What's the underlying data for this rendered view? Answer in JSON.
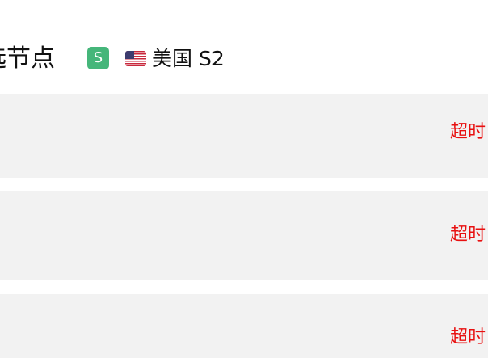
{
  "header": {
    "title": "选节点",
    "badge": "S",
    "node_country_flag": "us-flag-icon",
    "node_label": "美国 S2"
  },
  "nodes": [
    {
      "status": "超时"
    },
    {
      "status": "超时"
    },
    {
      "status": "超时"
    }
  ],
  "colors": {
    "badge_bg": "#45b67a",
    "status_timeout": "#e81010",
    "row_bg": "#f2f2f2"
  }
}
